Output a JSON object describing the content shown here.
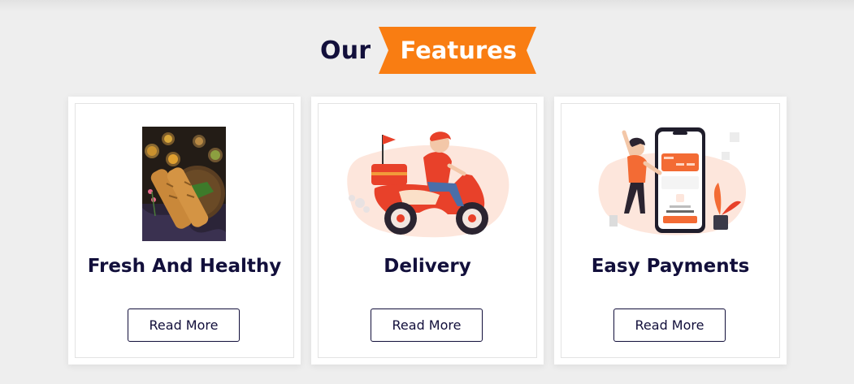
{
  "section": {
    "heading_prefix": "Our",
    "heading_highlight": "Features",
    "ribbon_color": "#f97d12",
    "heading_color": "#120f3b"
  },
  "cards": [
    {
      "title": "Fresh And Healthy",
      "button_label": "Read More",
      "image": "food-photo-icon"
    },
    {
      "title": "Delivery",
      "button_label": "Read More",
      "image": "delivery-scooter-icon"
    },
    {
      "title": "Easy Payments",
      "button_label": "Read More",
      "image": "mobile-payment-icon"
    }
  ]
}
